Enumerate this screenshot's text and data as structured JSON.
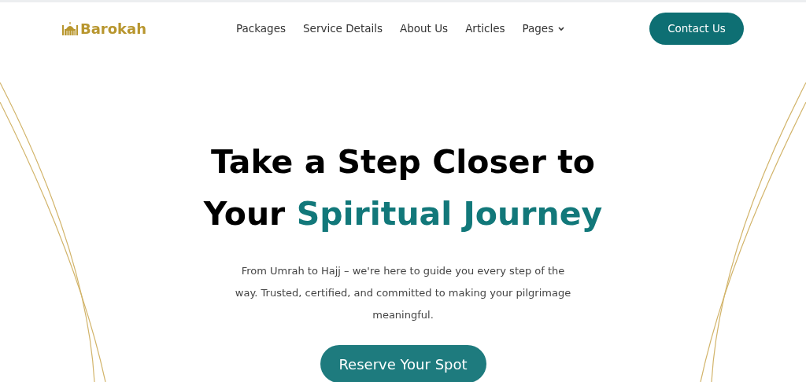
{
  "brand": {
    "name": "Barokah"
  },
  "nav": [
    {
      "label": "Packages",
      "dropdown": false
    },
    {
      "label": "Service Details",
      "dropdown": false
    },
    {
      "label": "About Us",
      "dropdown": false
    },
    {
      "label": "Articles",
      "dropdown": false
    },
    {
      "label": "Pages",
      "dropdown": true
    }
  ],
  "contact_button": "Contact Us",
  "hero": {
    "headline": [
      [
        {
          "text": "Take a Step Closer to",
          "accent": false
        }
      ],
      [
        {
          "text": "Your",
          "accent": false
        },
        {
          "text": "Spiritual Journey",
          "accent": true
        }
      ]
    ],
    "description": "From Umrah to Hajj – we're here to guide you every step of the way. Trusted, certified, and committed to making your pilgrimage meaningful.",
    "button": "Reserve Your Spot"
  }
}
